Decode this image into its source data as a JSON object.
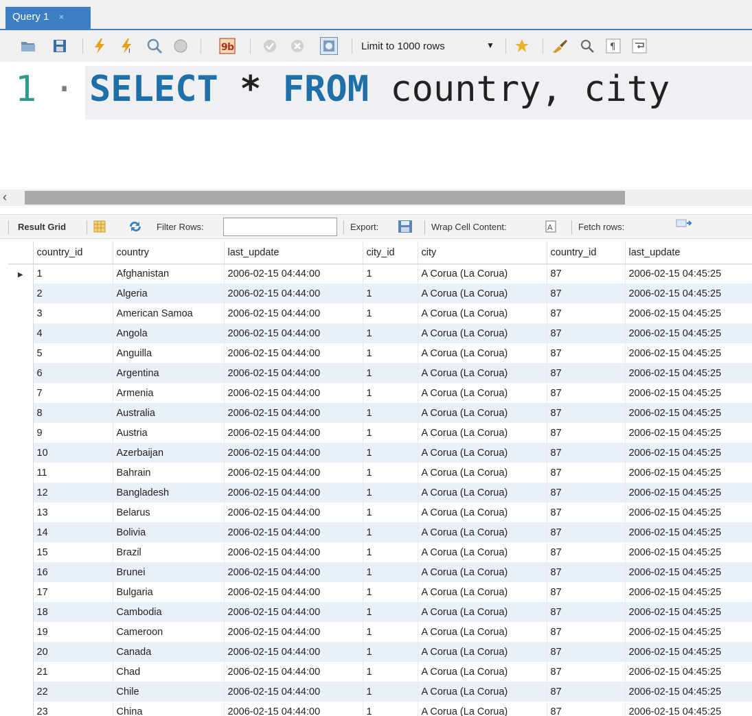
{
  "tab": {
    "title": "Query 1",
    "close": "×"
  },
  "toolbar": {
    "limit_label": "Limit to 1000 rows",
    "icons": [
      "folder-open-icon",
      "save-icon",
      "execute-icon",
      "execute-current-icon",
      "explain-icon",
      "stop-icon",
      "toggle-error-icon",
      "commit-icon",
      "rollback-icon",
      "autocommit-icon",
      "beautify-icon",
      "find-icon",
      "invisible-chars-icon",
      "wrap-icon"
    ]
  },
  "editor": {
    "line_number": "1",
    "line_dot": "·",
    "sql_tokens": {
      "select": "SELECT",
      "star": "*",
      "from": "FROM",
      "rest": " country, city"
    }
  },
  "result_toolbar": {
    "result_grid": "Result Grid",
    "filter_rows": "Filter Rows:",
    "filter_value": "",
    "export": "Export:",
    "wrap": "Wrap Cell Content:",
    "fetch": "Fetch rows:"
  },
  "grid": {
    "columns": [
      "country_id",
      "country",
      "last_update",
      "city_id",
      "city",
      "country_id",
      "last_update"
    ],
    "rows": [
      [
        "1",
        "Afghanistan",
        "2006-02-15 04:44:00",
        "1",
        "A Corua (La Corua)",
        "87",
        "2006-02-15 04:45:25"
      ],
      [
        "2",
        "Algeria",
        "2006-02-15 04:44:00",
        "1",
        "A Corua (La Corua)",
        "87",
        "2006-02-15 04:45:25"
      ],
      [
        "3",
        "American Samoa",
        "2006-02-15 04:44:00",
        "1",
        "A Corua (La Corua)",
        "87",
        "2006-02-15 04:45:25"
      ],
      [
        "4",
        "Angola",
        "2006-02-15 04:44:00",
        "1",
        "A Corua (La Corua)",
        "87",
        "2006-02-15 04:45:25"
      ],
      [
        "5",
        "Anguilla",
        "2006-02-15 04:44:00",
        "1",
        "A Corua (La Corua)",
        "87",
        "2006-02-15 04:45:25"
      ],
      [
        "6",
        "Argentina",
        "2006-02-15 04:44:00",
        "1",
        "A Corua (La Corua)",
        "87",
        "2006-02-15 04:45:25"
      ],
      [
        "7",
        "Armenia",
        "2006-02-15 04:44:00",
        "1",
        "A Corua (La Corua)",
        "87",
        "2006-02-15 04:45:25"
      ],
      [
        "8",
        "Australia",
        "2006-02-15 04:44:00",
        "1",
        "A Corua (La Corua)",
        "87",
        "2006-02-15 04:45:25"
      ],
      [
        "9",
        "Austria",
        "2006-02-15 04:44:00",
        "1",
        "A Corua (La Corua)",
        "87",
        "2006-02-15 04:45:25"
      ],
      [
        "10",
        "Azerbaijan",
        "2006-02-15 04:44:00",
        "1",
        "A Corua (La Corua)",
        "87",
        "2006-02-15 04:45:25"
      ],
      [
        "11",
        "Bahrain",
        "2006-02-15 04:44:00",
        "1",
        "A Corua (La Corua)",
        "87",
        "2006-02-15 04:45:25"
      ],
      [
        "12",
        "Bangladesh",
        "2006-02-15 04:44:00",
        "1",
        "A Corua (La Corua)",
        "87",
        "2006-02-15 04:45:25"
      ],
      [
        "13",
        "Belarus",
        "2006-02-15 04:44:00",
        "1",
        "A Corua (La Corua)",
        "87",
        "2006-02-15 04:45:25"
      ],
      [
        "14",
        "Bolivia",
        "2006-02-15 04:44:00",
        "1",
        "A Corua (La Corua)",
        "87",
        "2006-02-15 04:45:25"
      ],
      [
        "15",
        "Brazil",
        "2006-02-15 04:44:00",
        "1",
        "A Corua (La Corua)",
        "87",
        "2006-02-15 04:45:25"
      ],
      [
        "16",
        "Brunei",
        "2006-02-15 04:44:00",
        "1",
        "A Corua (La Corua)",
        "87",
        "2006-02-15 04:45:25"
      ],
      [
        "17",
        "Bulgaria",
        "2006-02-15 04:44:00",
        "1",
        "A Corua (La Corua)",
        "87",
        "2006-02-15 04:45:25"
      ],
      [
        "18",
        "Cambodia",
        "2006-02-15 04:44:00",
        "1",
        "A Corua (La Corua)",
        "87",
        "2006-02-15 04:45:25"
      ],
      [
        "19",
        "Cameroon",
        "2006-02-15 04:44:00",
        "1",
        "A Corua (La Corua)",
        "87",
        "2006-02-15 04:45:25"
      ],
      [
        "20",
        "Canada",
        "2006-02-15 04:44:00",
        "1",
        "A Corua (La Corua)",
        "87",
        "2006-02-15 04:45:25"
      ],
      [
        "21",
        "Chad",
        "2006-02-15 04:44:00",
        "1",
        "A Corua (La Corua)",
        "87",
        "2006-02-15 04:45:25"
      ],
      [
        "22",
        "Chile",
        "2006-02-15 04:44:00",
        "1",
        "A Corua (La Corua)",
        "87",
        "2006-02-15 04:45:25"
      ],
      [
        "23",
        "China",
        "2006-02-15 04:44:00",
        "1",
        "A Corua (La Corua)",
        "87",
        "2006-02-15 04:45:25"
      ]
    ]
  }
}
